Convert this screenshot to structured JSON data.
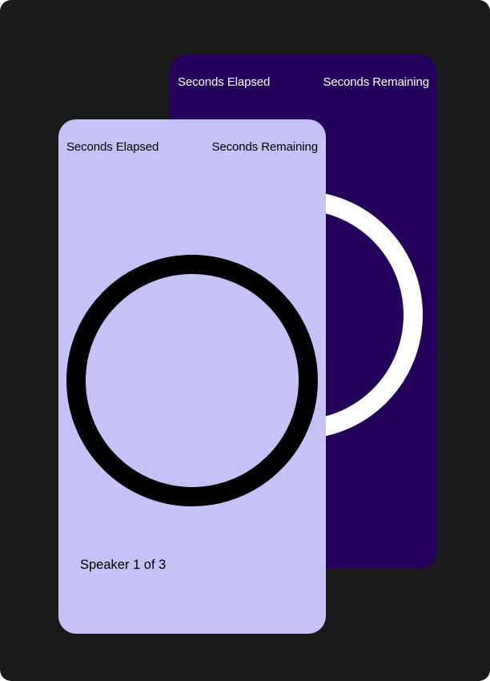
{
  "back_card": {
    "seconds_elapsed_label": "Seconds Elapsed",
    "seconds_remaining_label": "Seconds Remaining",
    "background_color": "#23005a",
    "ring_color": "#ffffff"
  },
  "front_card": {
    "seconds_elapsed_label": "Seconds Elapsed",
    "seconds_remaining_label": "Seconds Remaining",
    "speaker_text": "Speaker 1 of 3",
    "background_color": "#c5c2f8",
    "ring_color": "#000000"
  },
  "stage_color": "#1a1a1b"
}
